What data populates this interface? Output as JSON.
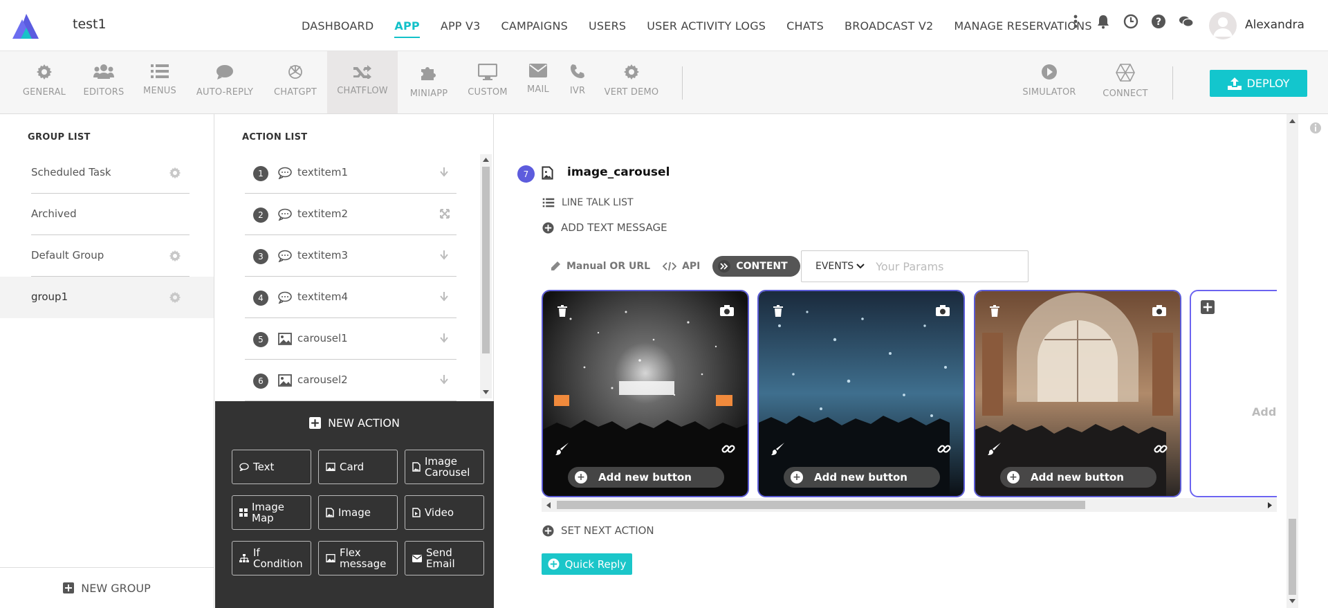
{
  "app": {
    "name": "test1"
  },
  "nav": {
    "items": [
      "DASHBOARD",
      "APP",
      "APP V3",
      "CAMPAIGNS",
      "USERS",
      "USER ACTIVITY LOGS",
      "CHATS",
      "BROADCAST V2",
      "MANAGE RESERVATIONS"
    ],
    "active": "APP"
  },
  "user": {
    "name": "Alexandra"
  },
  "toolbar": {
    "items": [
      {
        "label": "GENERAL",
        "icon": "gear-icon"
      },
      {
        "label": "EDITORS",
        "icon": "users-icon"
      },
      {
        "label": "MENUS",
        "icon": "list-icon"
      },
      {
        "label": "AUTO-REPLY",
        "icon": "chat-icon"
      },
      {
        "label": "CHATGPT",
        "icon": "openai-icon"
      },
      {
        "label": "CHATFLOW",
        "icon": "shuffle-icon"
      },
      {
        "label": "MINIAPP",
        "icon": "puzzle-icon"
      },
      {
        "label": "CUSTOM",
        "icon": "monitor-icon"
      },
      {
        "label": "MAIL",
        "icon": "mail-icon"
      },
      {
        "label": "IVR",
        "icon": "phone-icon"
      },
      {
        "label": "VERT DEMO",
        "icon": "gear-icon"
      }
    ],
    "active": "CHATFLOW",
    "right": [
      {
        "label": "SIMULATOR",
        "icon": "play-icon"
      },
      {
        "label": "CONNECT",
        "icon": "hexagon-icon"
      }
    ],
    "deploy_label": "DEPLOY"
  },
  "groups": {
    "title": "GROUP LIST",
    "items": [
      {
        "label": "Scheduled Task",
        "gear": true
      },
      {
        "label": "Archived",
        "gear": false
      },
      {
        "label": "Default Group",
        "gear": true
      },
      {
        "label": "group1",
        "gear": true,
        "selected": true
      }
    ],
    "new_label": "NEW GROUP"
  },
  "actions": {
    "title": "ACTION LIST",
    "items": [
      {
        "num": "1",
        "label": "textitem1",
        "type": "text"
      },
      {
        "num": "2",
        "label": "textitem2",
        "type": "text"
      },
      {
        "num": "3",
        "label": "textitem3",
        "type": "text"
      },
      {
        "num": "4",
        "label": "textitem4",
        "type": "text"
      },
      {
        "num": "5",
        "label": "carousel1",
        "type": "image"
      },
      {
        "num": "6",
        "label": "carousel2",
        "type": "image"
      }
    ],
    "new_action_label": "NEW ACTION",
    "buttons": [
      [
        "Text"
      ],
      [
        "Card"
      ],
      [
        "Image",
        "Carousel"
      ],
      [
        "Image",
        "Map"
      ],
      [
        "Image"
      ],
      [
        "Video"
      ],
      [
        "If",
        "Condition"
      ],
      [
        "Flex",
        "message"
      ],
      [
        "Send",
        "Email"
      ]
    ]
  },
  "step": {
    "num": "7",
    "title": "image_carousel",
    "line_talk_list": "LINE TALK LIST",
    "add_text_message": "ADD TEXT MESSAGE",
    "tabs": [
      "Manual OR URL",
      "API",
      "CONTENT"
    ],
    "events_label": "EVENTS",
    "params_placeholder": "Your Params",
    "card_button_label": "Add new button",
    "add_card_label": "Add",
    "set_next_action": "SET NEXT ACTION",
    "quick_reply": "Quick Reply"
  },
  "colors": {
    "accent": "#13c1c9",
    "step_badge": "#5d5cdd",
    "card_border": "#5b5bd6"
  }
}
